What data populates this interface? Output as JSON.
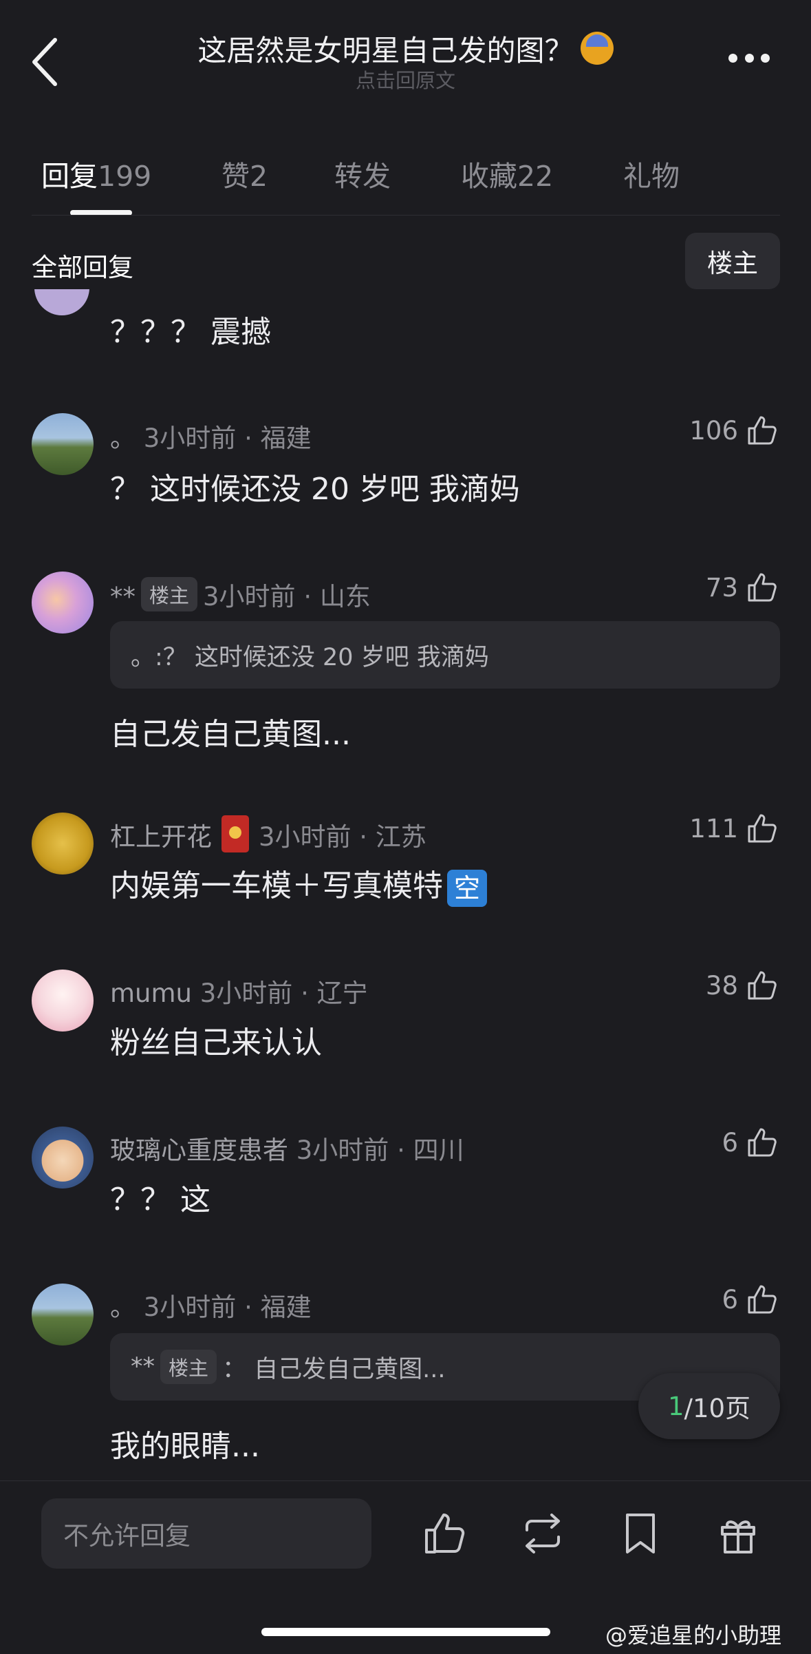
{
  "header": {
    "title": "这居然是女明星自己发的图？",
    "emoji": "fearful-face-emoji",
    "subtitle": "点击回原文"
  },
  "tabs": [
    {
      "label": "回复",
      "count": "199",
      "active": true
    },
    {
      "label": "赞",
      "count": "2",
      "active": false
    },
    {
      "label": "转发",
      "count": "",
      "active": false
    },
    {
      "label": "收藏",
      "count": "22",
      "active": false
    },
    {
      "label": "礼物",
      "count": "",
      "active": false
    }
  ],
  "section": {
    "title": "全部回复",
    "filter_button": "楼主"
  },
  "comments": [
    {
      "text": "？？？ 震撼"
    },
    {
      "name": "。",
      "meta": "3小时前 · 福建",
      "likes": "106",
      "text": "？ 这时候还没 20 岁吧 我滴妈"
    },
    {
      "name": "**",
      "badge": "楼主",
      "meta": "3小时前 · 山东",
      "likes": "73",
      "quote": "。:？ 这时候还没 20 岁吧 我滴妈",
      "text": "自己发自己黄图..."
    },
    {
      "name": "杠上开花",
      "meta": "3小时前 · 江苏",
      "likes": "111",
      "text": "内娱第一车模＋写真模特",
      "tag": "空"
    },
    {
      "name": "mumu",
      "meta": "3小时前 · 辽宁",
      "likes": "38",
      "text": "粉丝自己来认认"
    },
    {
      "name": "玻璃心重度患者",
      "meta": "3小时前 · 四川",
      "likes": "6",
      "text": "？？ 这"
    },
    {
      "name": "。",
      "meta": "3小时前 · 福建",
      "likes": "6",
      "quote_name": "**",
      "quote_badge": "楼主",
      "quote_text": "：  自己发自己黄图...",
      "text": "我的眼睛..."
    }
  ],
  "pager": {
    "current": "1",
    "total": "/10页"
  },
  "bottom_bar": {
    "input_placeholder": "不允许回复"
  },
  "watermark": "@爱追星的小助理",
  "colors": {
    "background": "#1c1c20",
    "pager_current": "#49c97a",
    "card": "#2a2a2f"
  }
}
